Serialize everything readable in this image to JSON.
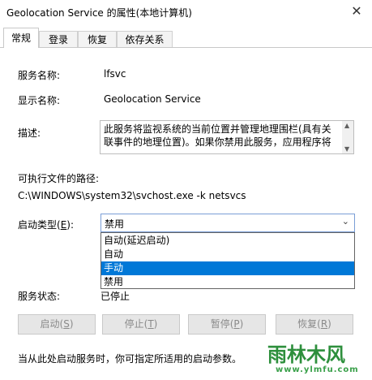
{
  "window": {
    "title": "Geolocation Service 的属性(本地计算机)",
    "close_glyph": "✕"
  },
  "tabs": [
    {
      "label": "常规",
      "active": true
    },
    {
      "label": "登录"
    },
    {
      "label": "恢复"
    },
    {
      "label": "依存关系"
    }
  ],
  "general": {
    "service_name_label": "服务名称:",
    "service_name": "lfsvc",
    "display_name_label": "显示名称:",
    "display_name": "Geolocation Service",
    "description_label": "描述:",
    "description": "此服务将监视系统的当前位置并管理地理围栏(具有关联事件的地理位置)。如果你禁用此服务，应用程序将",
    "path_label": "可执行文件的路径:",
    "path": "C:\\WINDOWS\\system32\\svchost.exe -k netsvcs",
    "startup_type_label_prefix": "启动类型(",
    "startup_type_label_key": "E",
    "startup_type_label_suffix": "):",
    "startup_type_selected": "禁用",
    "startup_options": [
      "自动(延迟启动)",
      "自动",
      "手动",
      "禁用"
    ],
    "highlighted_option_index": 2,
    "status_label": "服务状态:",
    "status_value": "已停止"
  },
  "buttons": {
    "start": {
      "text": "启动(",
      "key": "S",
      "end": ")"
    },
    "stop": {
      "text": "停止(",
      "key": "T",
      "end": ")"
    },
    "pause": {
      "text": "暂停(",
      "key": "P",
      "end": ")"
    },
    "resume": {
      "text": "恢复(",
      "key": "R",
      "end": ")"
    }
  },
  "footer_text": "当从此处启动服务时，你可指定所适用的启动参数。",
  "watermark": {
    "name": "雨林木风",
    "url": "www.ylmfu.com"
  },
  "colors": {
    "highlight": "#0078d7",
    "watermark": "#2d8f3c"
  }
}
